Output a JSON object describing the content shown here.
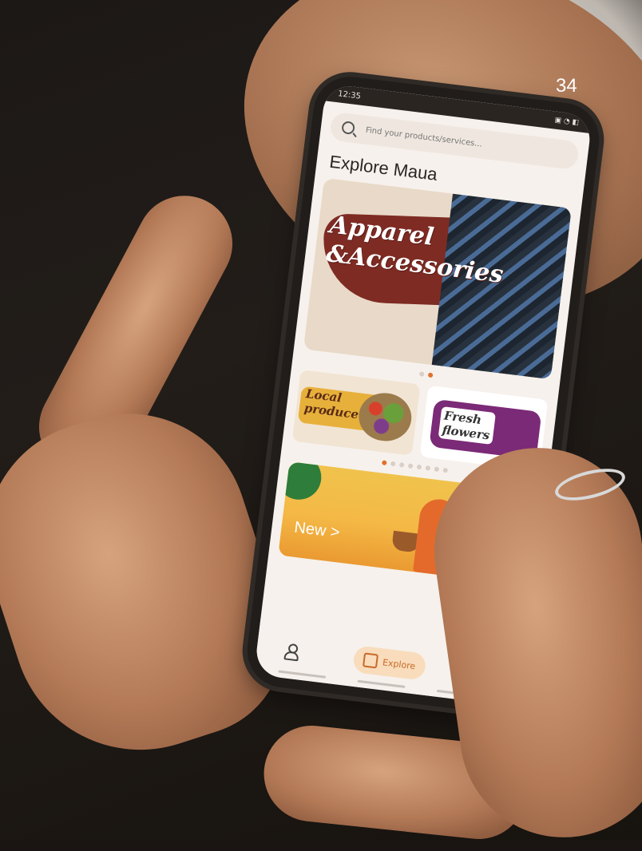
{
  "page": {
    "number": "34"
  },
  "status_bar": {
    "time": "12:35",
    "icons": "▣ ◔ ◧"
  },
  "search": {
    "placeholder": "Find your products/services..."
  },
  "heading": "Explore Maua",
  "hero": {
    "title_line1": "Apparel",
    "title_line2": "&Accessories"
  },
  "carousel_dots": {
    "count": 2,
    "active": 1
  },
  "categories": [
    {
      "label_line1": "Local",
      "label_line2": "produce"
    },
    {
      "label_line1": "Fresh",
      "label_line2": "flowers"
    }
  ],
  "category_dots": {
    "count": 8,
    "active": 0
  },
  "banner": {
    "label": "New >"
  },
  "nav": {
    "explore_label": "Explore"
  },
  "icons": [
    "search-icon",
    "user-icon",
    "store-icon",
    "bell-icon"
  ],
  "colors": {
    "accent": "#e0702c",
    "hero_brush": "#7e2b23",
    "banner": "#f0c34d"
  }
}
